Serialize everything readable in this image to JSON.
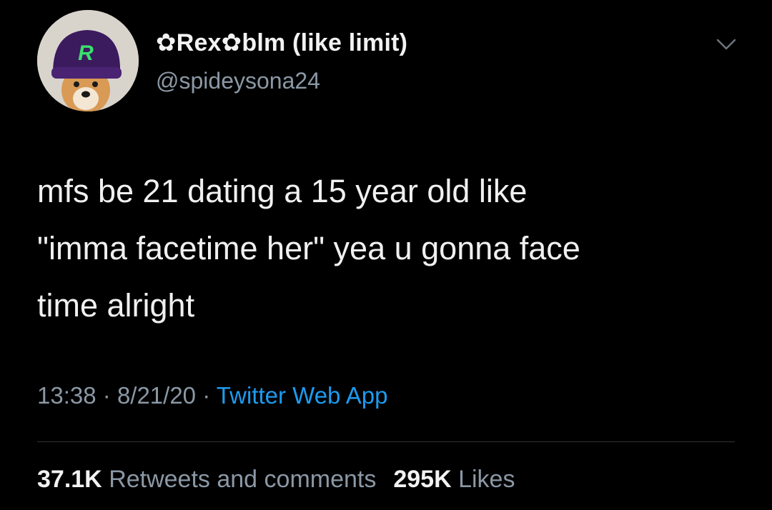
{
  "author": {
    "display_name": "✿Rex✿blm (like limit)",
    "handle": "@spideysona24",
    "avatar_icon": "shiba-dog-in-purple-beanie-icon",
    "avatar_badge_letter": "R"
  },
  "tweet": {
    "lines": [
      "mfs be 21 dating a 15 year old like",
      "\"imma facetime her\" yea u gonna face",
      "time alright"
    ]
  },
  "meta": {
    "time": "13:38",
    "separator": "·",
    "date": "8/21/20",
    "source": "Twitter Web App"
  },
  "stats": {
    "retweets_count": "37.1K",
    "retweets_label": "Retweets and comments",
    "likes_count": "295K",
    "likes_label": "Likes"
  },
  "colors": {
    "background": "#000000",
    "text": "#e7e9ea",
    "secondary": "#8b98a5",
    "link": "#1d9bf0",
    "divider": "#2f3336"
  }
}
